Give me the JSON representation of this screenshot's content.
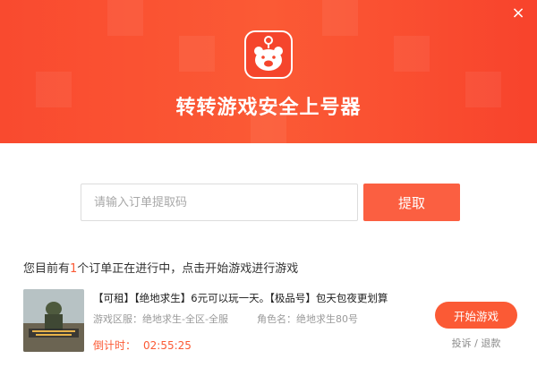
{
  "window": {
    "close_label": "×"
  },
  "header": {
    "app_title": "转转游戏安全上号器",
    "app_icon": "bear-logo-icon"
  },
  "search": {
    "placeholder": "请输入订单提取码",
    "value": "",
    "fetch_label": "提取"
  },
  "status": {
    "prefix": "您目前有",
    "count": "1",
    "suffix": "个订单正在进行中，点击开始游戏进行游戏"
  },
  "order": {
    "thumbnail_icon": "pubg-game-cover",
    "title": "【可租】【绝地求生】6元可以玩一天。【极品号】包天包夜更划算",
    "area_label": "游戏区服：",
    "area_value": "绝地求生-全区-全服",
    "role_label": "角色名：",
    "role_value": "绝地求生80号",
    "countdown_label": "倒计时：",
    "countdown_value": "02:55:25",
    "start_label": "开始游戏",
    "complain_label": "投诉",
    "separator": " / ",
    "refund_label": "退款"
  },
  "colors": {
    "accent": "#fb5a35",
    "header_start": "#f94a2f",
    "header_end": "#f8432c"
  }
}
